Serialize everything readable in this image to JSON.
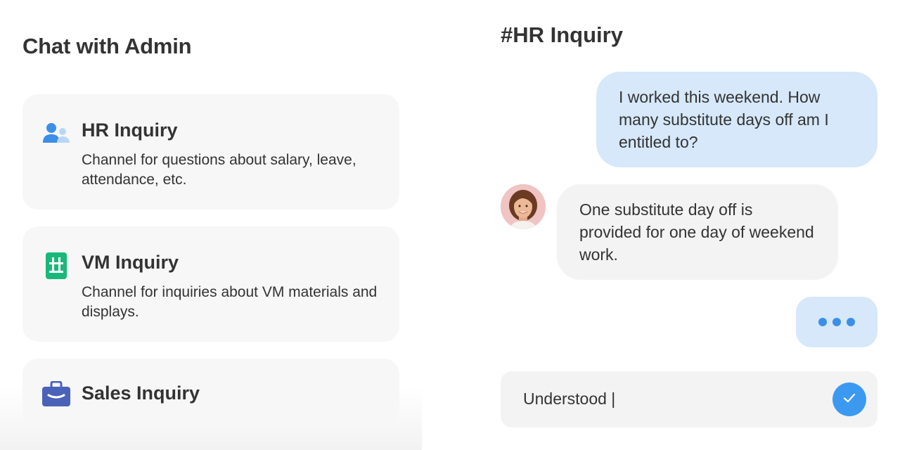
{
  "left": {
    "title": "Chat with Admin",
    "channels": [
      {
        "title": "HR Inquiry",
        "description": "Channel for questions about salary, leave, attendance, etc.",
        "icon": "users-icon",
        "color": "#3b8fe8"
      },
      {
        "title": "VM Inquiry",
        "description": "Channel for inquiries about VM materials and displays.",
        "icon": "display-board-icon",
        "color": "#19b87a"
      },
      {
        "title": "Sales Inquiry",
        "description": "",
        "icon": "briefcase-icon",
        "color": "#4a63b8"
      }
    ]
  },
  "chat": {
    "title": "#HR Inquiry",
    "messages": [
      {
        "sender": "user",
        "text": "I worked this weekend. How many substitute days off am I entitled to?"
      },
      {
        "sender": "admin",
        "text": "One substitute day off is provided for one day of weekend work."
      }
    ],
    "typing_indicator": true,
    "input_value": "Understood |",
    "send_icon": "checkmark-icon",
    "colors": {
      "user_bubble": "#d6e8f9",
      "admin_bubble": "#f3f3f3",
      "accent": "#3b9af0"
    }
  }
}
